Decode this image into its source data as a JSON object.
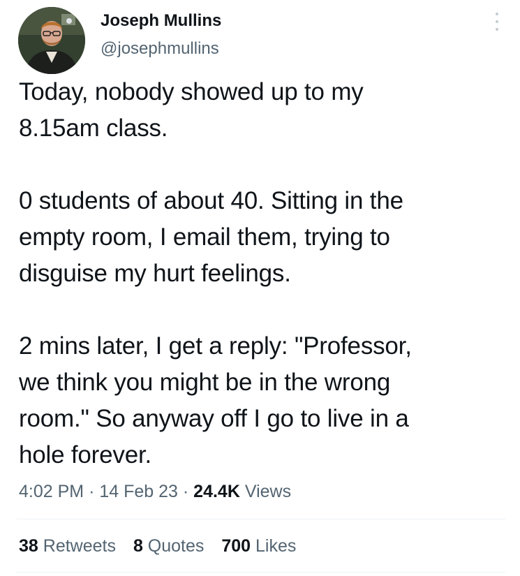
{
  "author": {
    "name": "Joseph Mullins",
    "handle": "@josephmullins"
  },
  "tweet": {
    "text": "Today, nobody showed up to my\n8.15am class.\n\n0 students of about 40.  Sitting in the\nempty room, I email them, trying to\ndisguise my hurt feelings.\n\n2 mins later, I get a reply: \"Professor,\nwe think you might be in the wrong\nroom.\" So anyway off I go to live in a\nhole forever.",
    "time": "4:02 PM",
    "separator": "·",
    "date": "14 Feb 23",
    "views_count": "24.4K",
    "views_label": "Views"
  },
  "stats": {
    "retweets_count": "38",
    "retweets_label": "Retweets",
    "quotes_count": "8",
    "quotes_label": "Quotes",
    "likes_count": "700",
    "likes_label": "Likes"
  },
  "icons": {
    "more": "more-options-icon"
  },
  "colors": {
    "text_primary": "#0f1419",
    "text_secondary": "#536471",
    "divider": "#eff3f4"
  }
}
